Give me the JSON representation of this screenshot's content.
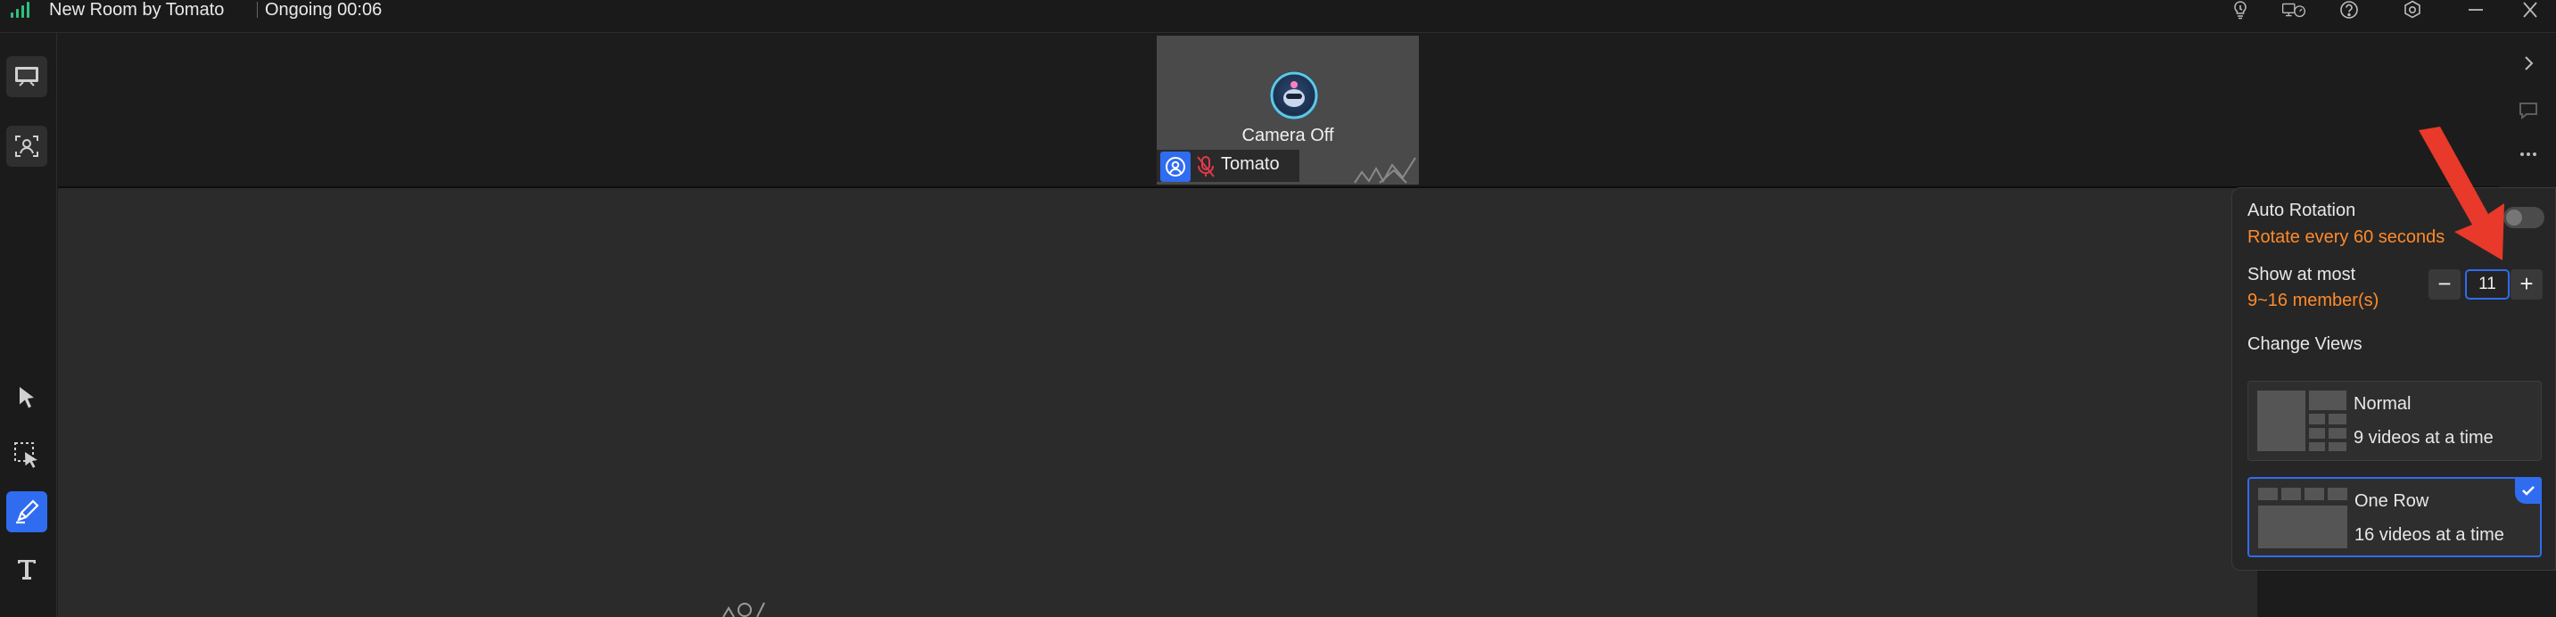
{
  "titlebar": {
    "app_title": "New Room by Tomato",
    "status": "Ongoing 00:06",
    "icons": [
      "signal-icon",
      "lightbulb-icon",
      "screen-speed-icon",
      "help-icon",
      "settings-icon",
      "minimize-icon",
      "close-icon"
    ]
  },
  "left_toolbar": {
    "items": [
      "whiteboard-icon",
      "participant-share-icon",
      "select-cursor-icon",
      "area-select-icon",
      "pen-icon",
      "text-icon"
    ],
    "active": "pen-icon"
  },
  "video_strip": {
    "camera_status": "Camera Off",
    "participant_name": "Tomato"
  },
  "right_rail": {
    "icons": [
      "chevron-right-icon",
      "chat-icon",
      "more-icon"
    ]
  },
  "view_panel": {
    "auto_rotation_label": "Auto Rotation",
    "auto_rotation_sub": "Rotate every 60 seconds",
    "auto_rotation_on": false,
    "show_at_most_label": "Show at most",
    "show_at_most_sub": "9~16 member(s)",
    "show_at_most_value": "11",
    "decrement": "−",
    "increment": "+",
    "change_views_label": "Change Views",
    "views": [
      {
        "title": "Normal",
        "desc": "9 videos at a time",
        "selected": false
      },
      {
        "title": "One Row",
        "desc": "16 videos at a time",
        "selected": true
      }
    ]
  },
  "colors": {
    "accent": "#2f6cf0",
    "warning_text": "#ff8a2b",
    "signal": "#2ec27e",
    "arrow": "#e8392a"
  }
}
